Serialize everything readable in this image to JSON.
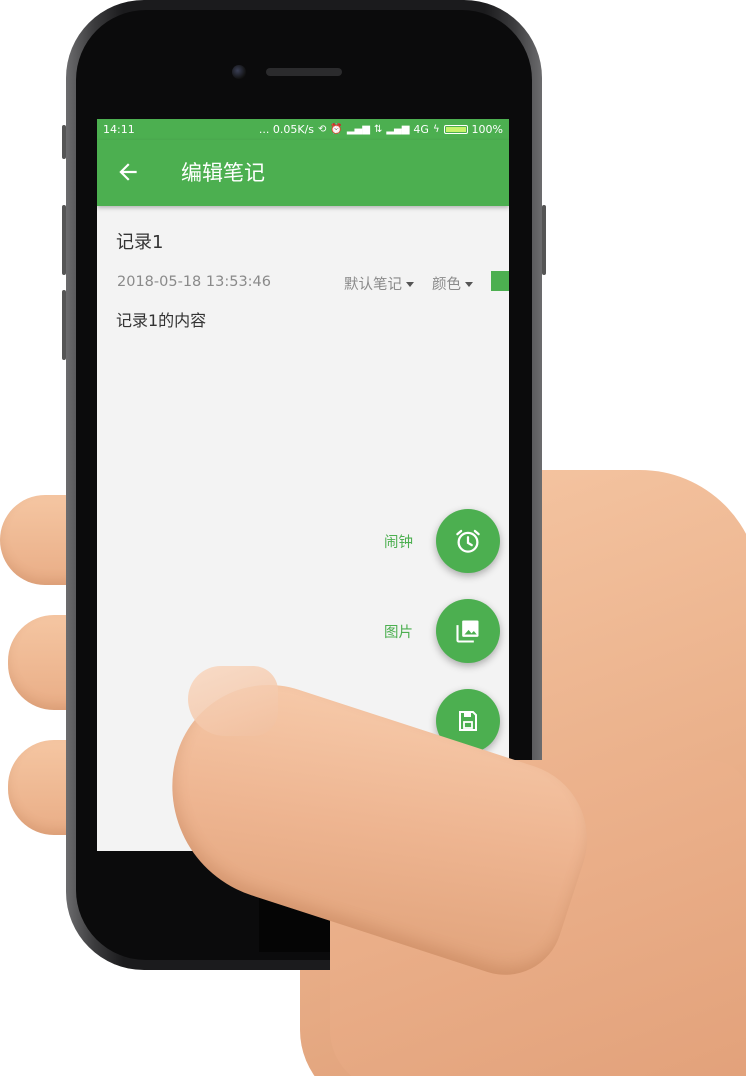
{
  "status_bar": {
    "time": "14:11",
    "network_speed": "... 0.05K/s",
    "network_type": "4G",
    "battery_level": "100%",
    "battery_fraction": 1.0
  },
  "toolbar": {
    "title": "编辑笔记",
    "back_icon": "arrow-left-icon"
  },
  "note": {
    "title": "记录1",
    "datetime": "2018-05-18 13:53:46",
    "category": "默认笔记",
    "color_label": "颜色",
    "content": "记录1的内容"
  },
  "fab_menu": {
    "items": [
      {
        "label": "闹钟",
        "icon": "alarm-clock-icon"
      },
      {
        "label": "图片",
        "icon": "image-icon"
      },
      {
        "label": "",
        "icon": "save-icon"
      }
    ]
  },
  "colors": {
    "accent": "#4caf50",
    "background": "#f3f3f3",
    "text_primary": "#333333",
    "text_secondary": "#8a8a8a"
  }
}
